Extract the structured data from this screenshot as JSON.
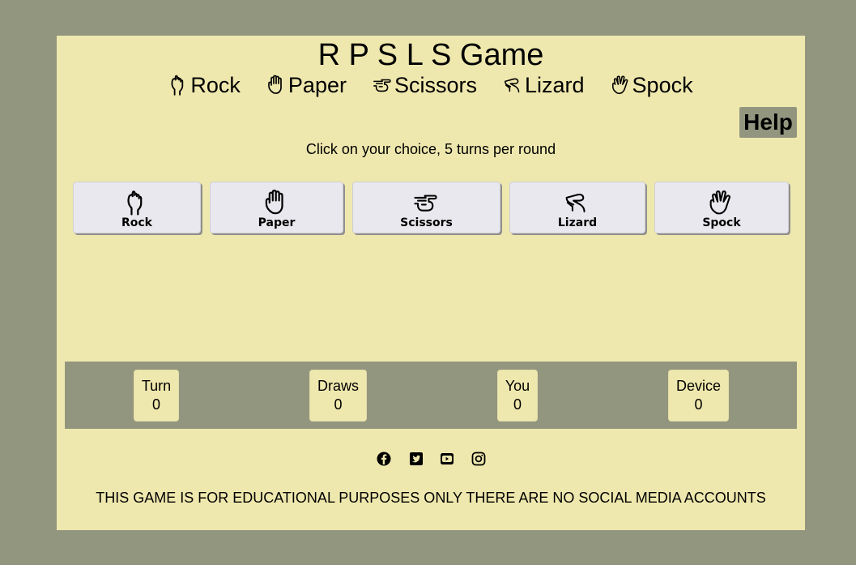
{
  "title": "R P S L S Game",
  "legend": [
    "Rock",
    "Paper",
    "Scissors",
    "Lizard",
    "Spock"
  ],
  "help_label": "Help",
  "instructions": "Click on your choice, 5 turns per round",
  "choices": [
    {
      "label": "Rock",
      "icon": "hand-fist-icon"
    },
    {
      "label": "Paper",
      "icon": "hand-paper-icon"
    },
    {
      "label": "Scissors",
      "icon": "hand-scissors-icon"
    },
    {
      "label": "Lizard",
      "icon": "hand-lizard-icon"
    },
    {
      "label": "Spock",
      "icon": "hand-spock-icon"
    }
  ],
  "scores": [
    {
      "label": "Turn",
      "value": "0"
    },
    {
      "label": "Draws",
      "value": "0"
    },
    {
      "label": "You",
      "value": "0"
    },
    {
      "label": "Device",
      "value": "0"
    }
  ],
  "social": [
    "facebook-icon",
    "twitter-icon",
    "youtube-icon",
    "instagram-icon"
  ],
  "disclaimer": "THIS GAME IS FOR EDUCATIONAL PURPOSES ONLY THERE ARE NO SOCIAL MEDIA ACCOUNTS",
  "colors": {
    "background": "#93967f",
    "panel": "#efe8ae",
    "button": "#e9e8ee"
  }
}
